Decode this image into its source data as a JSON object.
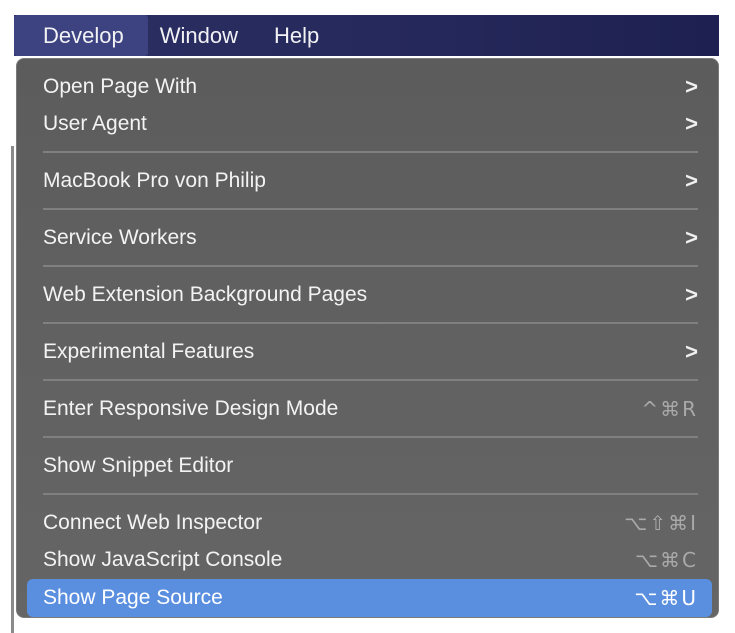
{
  "menubar": {
    "items": [
      {
        "label": "Develop"
      },
      {
        "label": "Window"
      },
      {
        "label": "Help"
      }
    ]
  },
  "menu": {
    "items": [
      {
        "label": "Open Page With"
      },
      {
        "label": "User Agent"
      },
      {
        "label": "MacBook Pro von Philip"
      },
      {
        "label": "Service Workers"
      },
      {
        "label": "Web Extension Background Pages"
      },
      {
        "label": "Experimental Features"
      },
      {
        "label": "Enter Responsive Design Mode",
        "shortcut": "^⌘R"
      },
      {
        "label": "Show Snippet Editor"
      },
      {
        "label": "Connect Web Inspector",
        "shortcut": "⌥⇧⌘I"
      },
      {
        "label": "Show JavaScript Console",
        "shortcut": "⌥⌘C"
      },
      {
        "label": "Show Page Source",
        "shortcut": "⌥⌘U"
      }
    ],
    "chevron": ">"
  }
}
